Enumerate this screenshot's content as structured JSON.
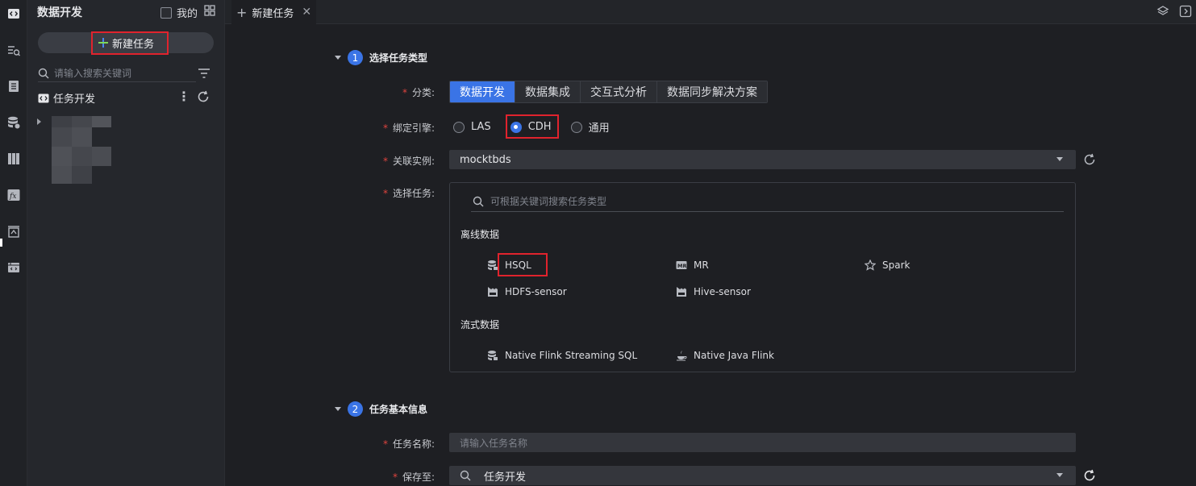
{
  "activity": {
    "icons": [
      "code-icon",
      "query-icon",
      "document-icon",
      "database-icon",
      "columns-icon",
      "function-icon",
      "deploy-icon",
      "terminal-icon"
    ]
  },
  "sidebar": {
    "title": "数据开发",
    "mine_label": "我的",
    "new_task_label": "新建任务",
    "search_placeholder": "请输入搜索关键词",
    "tree_root_label": "任务开发"
  },
  "tabs": [
    {
      "label": "新建任务",
      "closable": true
    }
  ],
  "section1": {
    "number": "1",
    "title": "选择任务类型",
    "category_label": "分类:",
    "categories": [
      "数据开发",
      "数据集成",
      "交互式分析",
      "数据同步解决方案"
    ],
    "active_category": "数据开发",
    "engine_label": "绑定引擎:",
    "engines": [
      "LAS",
      "CDH",
      "通用"
    ],
    "selected_engine": "CDH",
    "instance_label": "关联实例:",
    "instance_value": "mocktbds",
    "task_label": "选择任务:",
    "task_search_placeholder": "可根据关键词搜索任务类型",
    "groups": [
      {
        "title": "离线数据",
        "items": [
          {
            "label": "HSQL",
            "icon": "database-stack-icon"
          },
          {
            "label": "MR",
            "icon": "mr-icon"
          },
          {
            "label": "Spark",
            "icon": "star-icon"
          },
          {
            "label": "HDFS-sensor",
            "icon": "sensor-icon"
          },
          {
            "label": "Hive-sensor",
            "icon": "sensor-icon"
          }
        ]
      },
      {
        "title": "流式数据",
        "items": [
          {
            "label": "Native Flink Streaming SQL",
            "icon": "database-stack-icon"
          },
          {
            "label": "Native Java Flink",
            "icon": "java-icon"
          }
        ]
      }
    ]
  },
  "section2": {
    "number": "2",
    "title": "任务基本信息",
    "name_label": "任务名称:",
    "name_placeholder": "请输入任务名称",
    "save_label": "保存至:",
    "save_value": "任务开发"
  },
  "colors": {
    "accent": "#3a74e6",
    "highlight_border": "#e0232d",
    "required_star": "#e0443e"
  }
}
